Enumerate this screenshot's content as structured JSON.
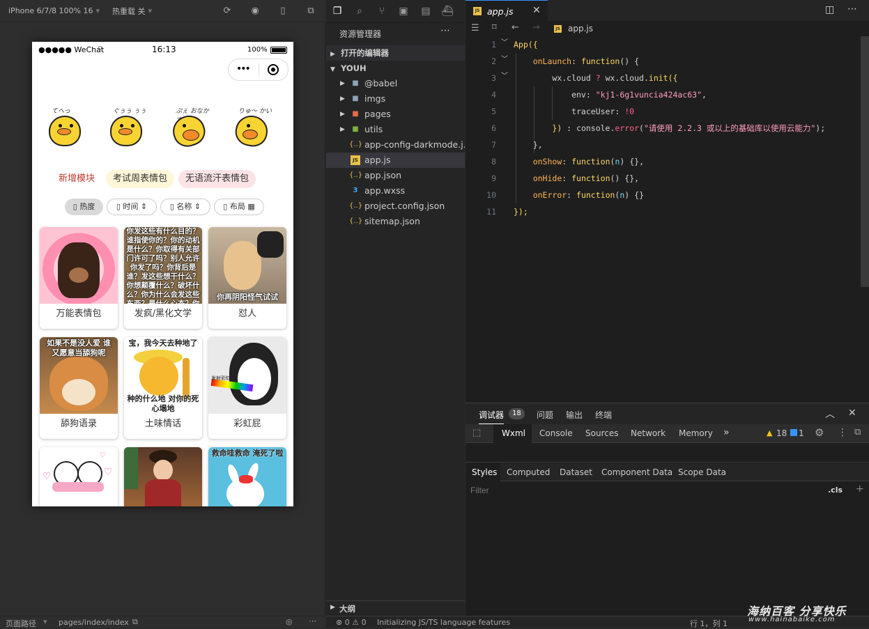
{
  "simulator": {
    "device": "iPhone 6/7/8 100% 16",
    "hot_reload": "热重载 关",
    "status_left": "●●●●● WeChat",
    "status_time": "16:13",
    "status_battery": "100%",
    "tags": [
      "新增模块",
      "考试周表情包",
      "无语流汗表情包"
    ],
    "filters": [
      "热度",
      "时间",
      "名称",
      "布局"
    ],
    "cards": [
      {
        "label": "万能表情包",
        "overlay": ""
      },
      {
        "label": "发疯/黑化文学",
        "overlay": "你发这些有什么目的？谁指使你的？你的动机是什么？你取得有关部门许可了吗？别人允许你发了吗？你背后是谁？发这些想干什么？你想颠覆什么？破坏什么？你为什么会发这些东西？是什么心态？你用"
      },
      {
        "label": "怼人",
        "overlay": "你再阴阳怪气试试"
      },
      {
        "label": "舔狗语录",
        "overlay": "如果不是没人爱 谁又愿意当舔狗呢"
      },
      {
        "label": "土味情话",
        "overlay_top": "宝，我今天去种地了",
        "overlay": "种的什么地 对你的死心塌地"
      },
      {
        "label": "彩虹屁",
        "overlay": "发射彩虹屁"
      },
      {
        "label": "",
        "overlay": ""
      },
      {
        "label": "",
        "overlay": ""
      },
      {
        "label": "",
        "overlay": "救命哇救命 淹死了啦"
      }
    ],
    "page_path_label": "页面路径",
    "page_path": "pages/index/index"
  },
  "explorer": {
    "title": "资源管理器",
    "open_editors": "打开的编辑器",
    "root": "YOUH",
    "items": [
      {
        "name": "@babel",
        "type": "folder"
      },
      {
        "name": "imgs",
        "type": "folder"
      },
      {
        "name": "pages",
        "type": "folder"
      },
      {
        "name": "utils",
        "type": "folder"
      },
      {
        "name": "app-config-darkmode.j...",
        "type": "json"
      },
      {
        "name": "app.js",
        "type": "js"
      },
      {
        "name": "app.json",
        "type": "json"
      },
      {
        "name": "app.wxss",
        "type": "css"
      },
      {
        "name": "project.config.json",
        "type": "json"
      },
      {
        "name": "sitemap.json",
        "type": "json"
      }
    ],
    "outline": "大纲"
  },
  "editor": {
    "tab": "app.js",
    "breadcrumb": "app.js",
    "line_numbers": [
      "1",
      "2",
      "3",
      "4",
      "5",
      "6",
      "7",
      "8",
      "9",
      "10",
      "11"
    ]
  },
  "devtools": {
    "top_tabs": [
      "调试器",
      "问题",
      "输出",
      "终端"
    ],
    "debugger_count": "18",
    "panel_tabs": [
      "Wxml",
      "Console",
      "Sources",
      "Network",
      "Memory"
    ],
    "warn_count": "18",
    "info_count": "1",
    "style_tabs": [
      "Styles",
      "Computed",
      "Dataset",
      "Component Data",
      "Scope Data"
    ],
    "filter_placeholder": "Filter",
    "cls": ".cls"
  },
  "statusbar": {
    "problems": "⊗ 0 ⚠ 0",
    "message": "Initializing JS/TS language features",
    "position": "行 1，列 1"
  },
  "watermark": {
    "title": "海纳百客 分享快乐",
    "url": "www.hainabaike.com"
  },
  "colors": {
    "accent": "#3794ff",
    "tag_red": "#c0392b"
  }
}
